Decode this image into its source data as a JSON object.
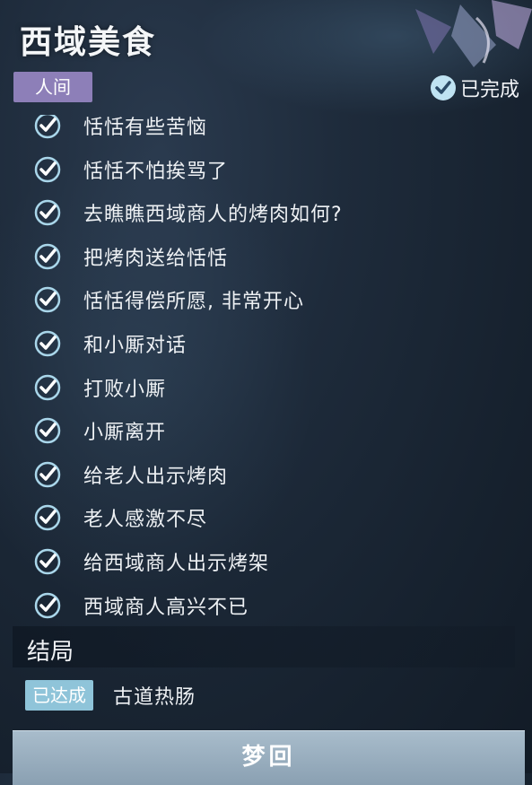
{
  "quest": {
    "title": "西域美食",
    "tag": "人间",
    "status": "已完成"
  },
  "steps": [
    {
      "text": "恬恬有些苦恼"
    },
    {
      "text": "恬恬不怕挨骂了"
    },
    {
      "text": "去瞧瞧西域商人的烤肉如何?"
    },
    {
      "text": "把烤肉送给恬恬"
    },
    {
      "text": "恬恬得偿所愿, 非常开心"
    },
    {
      "text": "和小厮对话"
    },
    {
      "text": "打败小厮"
    },
    {
      "text": "小厮离开"
    },
    {
      "text": "给老人出示烤肉"
    },
    {
      "text": "老人感激不尽"
    },
    {
      "text": "给西域商人出示烤架"
    },
    {
      "text": "西域商人高兴不已"
    }
  ],
  "ending": {
    "section_title": "结局",
    "badge": "已达成",
    "name": "古道热肠"
  },
  "button": {
    "label": "梦回"
  },
  "colors": {
    "tag_bg": "#8d7fb8",
    "badge_bg": "#8fc4d9",
    "check_blue": "#9fd0e8",
    "button_bg": "#9fb3c3"
  },
  "icons": {
    "check": "check-circle-icon",
    "emblem": "emblem-icon"
  }
}
